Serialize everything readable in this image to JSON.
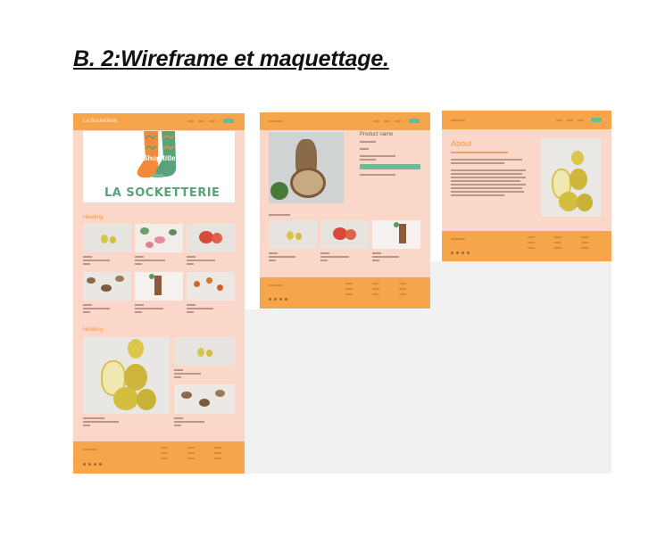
{
  "document": {
    "title": "B. 2:Wireframe et maquettage."
  },
  "frames": {
    "home": {
      "logo": "La Socketterie",
      "hero_overlay_text": "Shop title",
      "hero_brand": "LA SOCKETTERIE",
      "heading_1": "Heading",
      "heading_2": "Heading"
    },
    "product": {
      "product_name": "Product name"
    },
    "about": {
      "title": "About"
    }
  },
  "colors": {
    "page_bg": "#fbd7c9",
    "nav_bar": "#f6a54a",
    "accent_button": "#6fb898",
    "heading_text": "#f39a3a"
  }
}
